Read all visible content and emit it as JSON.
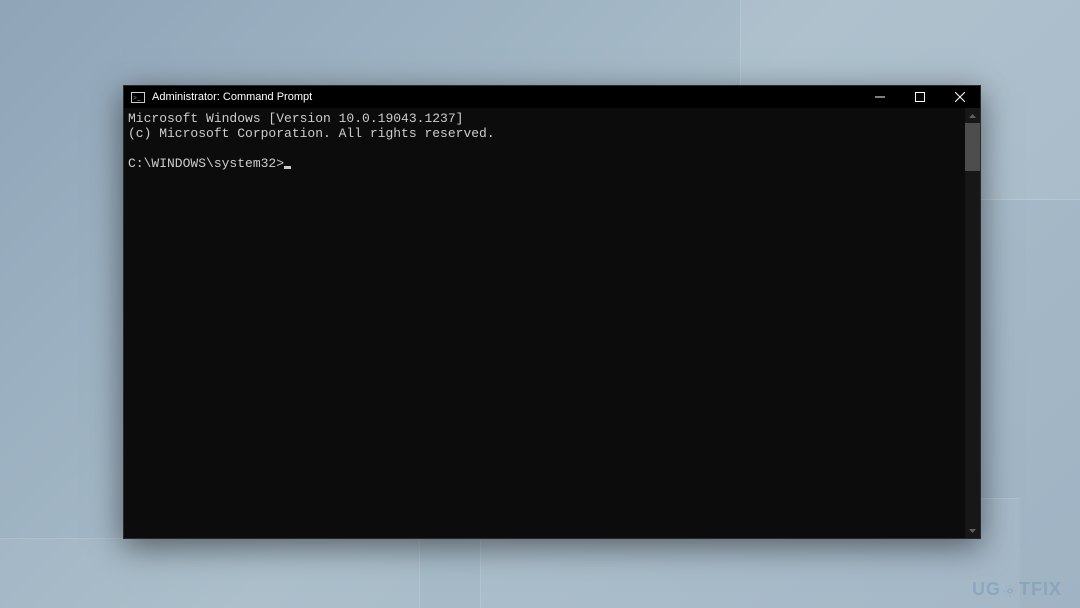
{
  "window": {
    "title": "Administrator: Command Prompt"
  },
  "terminal": {
    "line1": "Microsoft Windows [Version 10.0.19043.1237]",
    "line2": "(c) Microsoft Corporation. All rights reserved.",
    "blank": "",
    "prompt": "C:\\WINDOWS\\system32>"
  },
  "watermark": {
    "part1": "UG",
    "part2": "TFIX"
  }
}
